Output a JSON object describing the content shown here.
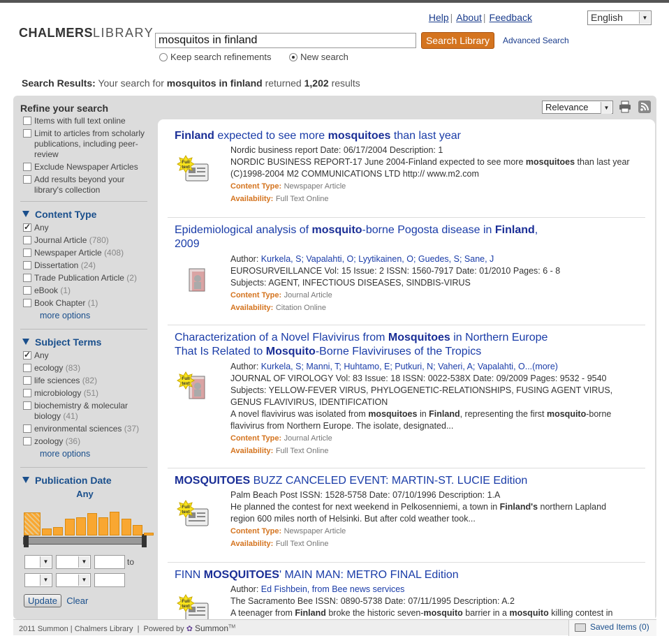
{
  "header": {
    "logo_left": "CHALMERS",
    "logo_right": "LIBRARY",
    "links": [
      "Help",
      "About",
      "Feedback"
    ],
    "language": "English"
  },
  "search": {
    "query": "mosquitos in finland",
    "button_label": "Search Library",
    "advanced_label": "Advanced Search",
    "keep_refinements_label": "Keep search refinements",
    "new_search_label": "New search"
  },
  "summary": {
    "prefix": "Search Results:",
    "middle": "Your search for",
    "query": "mosquitos in finland",
    "returned": "returned",
    "count": "1,202",
    "suffix": "results"
  },
  "sort": {
    "selected": "Relevance"
  },
  "sidebar": {
    "refine_title": "Refine your search",
    "refine_options": [
      "Items with full text online",
      "Limit to articles from scholarly publications, including peer-review",
      "Exclude Newspaper Articles",
      "Add results beyond your library's collection"
    ],
    "content_type": {
      "title": "Content Type",
      "any": "Any",
      "items": [
        {
          "label": "Journal Article",
          "count": "(780)"
        },
        {
          "label": "Newspaper Article",
          "count": "(408)"
        },
        {
          "label": "Dissertation",
          "count": "(24)"
        },
        {
          "label": "Trade Publication Article",
          "count": "(2)"
        },
        {
          "label": "eBook",
          "count": "(1)"
        },
        {
          "label": "Book Chapter",
          "count": "(1)"
        }
      ],
      "more": "more options"
    },
    "subject_terms": {
      "title": "Subject Terms",
      "any": "Any",
      "items": [
        {
          "label": "ecology",
          "count": "(83)"
        },
        {
          "label": "life sciences",
          "count": "(82)"
        },
        {
          "label": "microbiology",
          "count": "(51)"
        },
        {
          "label": "biochemistry & molecular biology",
          "count": "(41)"
        },
        {
          "label": "environmental sciences",
          "count": "(37)"
        },
        {
          "label": "zoology",
          "count": "(36)"
        }
      ],
      "more": "more options"
    },
    "publication_date": {
      "title": "Publication Date",
      "range": "Any",
      "histogram": [
        0.75,
        0.22,
        0.28,
        0.55,
        0.58,
        0.72,
        0.58,
        0.78,
        0.55,
        0.35,
        0.1
      ],
      "to_label": "to",
      "update_label": "Update",
      "clear_label": "Clear"
    }
  },
  "results": [
    {
      "title_parts": [
        [
          "b",
          "Finland"
        ],
        [
          "t",
          " expected to see more "
        ],
        [
          "b",
          "mosquitoes"
        ],
        [
          "t",
          " than last year"
        ]
      ],
      "full_text": true,
      "icon": "newspaper-icon",
      "lines": [
        [
          [
            "t",
            "Nordic business report Date: 06/17/2004 Description: 1"
          ]
        ],
        [
          [
            "t",
            "NORDIC BUSINESS REPORT-17 June 2004-Finland expected to see more "
          ],
          [
            "b",
            "mosquitoes"
          ],
          [
            "t",
            " than last year"
          ]
        ],
        [
          [
            "t",
            "(C)1998-2004 M2 COMMUNICATIONS LTD http:// www.m2.com"
          ]
        ]
      ],
      "content_type": "Newspaper Article",
      "availability": "Full Text Online"
    },
    {
      "title_parts": [
        [
          "t",
          "Epidemiological analysis of "
        ],
        [
          "b",
          "mosquito"
        ],
        [
          "t",
          "-borne Pogosta disease in "
        ],
        [
          "b",
          "Finland"
        ],
        [
          "t",
          ","
        ]
      ],
      "title_line2": "2009",
      "full_text": false,
      "icon": "journal-icon",
      "lines": [
        [
          [
            "t",
            "Author: "
          ],
          [
            "l",
            "Kurkela, S; Vapalahti, O; Lyytikainen, O; Guedes, S; Sane, J"
          ]
        ],
        [
          [
            "t",
            "EUROSURVEILLANCE Vol: 15 Issue: 2 ISSN: 1560-7917 Date: 01/2010 Pages: 6 - 8"
          ]
        ],
        [
          [
            "t",
            "Subjects: AGENT, INFECTIOUS DISEASES, SINDBIS-VIRUS"
          ]
        ]
      ],
      "content_type": "Journal Article",
      "availability": "Citation Online"
    },
    {
      "title_parts": [
        [
          "t",
          "Characterization of a Novel Flavivirus from "
        ],
        [
          "b",
          "Mosquitoes"
        ],
        [
          "t",
          " in Northern Europe"
        ]
      ],
      "title_line2_parts": [
        [
          "t",
          "That Is Related to "
        ],
        [
          "b",
          "Mosquito"
        ],
        [
          "t",
          "-Borne Flaviviruses of the Tropics"
        ]
      ],
      "full_text": true,
      "icon": "journal-icon",
      "lines": [
        [
          [
            "t",
            "Author: "
          ],
          [
            "l",
            "Kurkela, S; Manni, T; Huhtamo, E; Putkuri, N; Vaheri, A; Vapalahti, O...(more)"
          ]
        ],
        [
          [
            "t",
            "JOURNAL OF VIROLOGY Vol: 83 Issue: 18 ISSN: 0022-538X Date: 09/2009 Pages: 9532 - 9540"
          ]
        ],
        [
          [
            "t",
            "Subjects: YELLOW-FEVER VIRUS, PHYLOGENETIC-RELATIONSHIPS, FUSING AGENT VIRUS,"
          ]
        ],
        [
          [
            "t",
            "GENUS FLAVIVIRUS, IDENTIFICATION"
          ]
        ],
        [
          [
            "t",
            "A novel flavivirus was isolated from "
          ],
          [
            "b",
            "mosquitoes"
          ],
          [
            "t",
            " in "
          ],
          [
            "b",
            "Finland"
          ],
          [
            "t",
            ", representing the first "
          ],
          [
            "b",
            "mosquito"
          ],
          [
            "t",
            "-borne"
          ]
        ],
        [
          [
            "t",
            "flavivirus from Northern Europe. The isolate, designated..."
          ]
        ]
      ],
      "content_type": "Journal Article",
      "availability": "Full Text Online"
    },
    {
      "title_parts": [
        [
          "b",
          "MOSQUITOES"
        ],
        [
          "t",
          " BUZZ CANCELED EVENT: MARTIN-ST. LUCIE Edition"
        ]
      ],
      "full_text": true,
      "icon": "newspaper-icon",
      "lines": [
        [
          [
            "t",
            "Palm Beach Post ISSN: 1528-5758 Date: 07/10/1996 Description: 1.A"
          ]
        ],
        [
          [
            "t",
            "He planned the contest for next weekend in Pelkosenniemi, a town in "
          ],
          [
            "b",
            "Finland's"
          ],
          [
            "t",
            " northern Lapland"
          ]
        ],
        [
          [
            "t",
            "region 600 miles north of Helsinki. But after cold weather took..."
          ]
        ]
      ],
      "content_type": "Newspaper Article",
      "availability": "Full Text Online"
    },
    {
      "title_parts": [
        [
          "t",
          "FINN "
        ],
        [
          "b",
          "MOSQUITOES"
        ],
        [
          "t",
          "' MAIN MAN: METRO FINAL Edition"
        ]
      ],
      "full_text": true,
      "icon": "newspaper-icon",
      "lines": [
        [
          [
            "t",
            "Author: "
          ],
          [
            "l",
            "Ed Fishbein, from Bee news services"
          ]
        ],
        [
          [
            "t",
            "The Sacramento Bee ISSN: 0890-5738 Date: 07/11/1995 Description: A.2"
          ]
        ],
        [
          [
            "t",
            "A teenager from "
          ],
          [
            "b",
            "Finland"
          ],
          [
            "t",
            " broke the historic seven-"
          ],
          [
            "b",
            "mosquito"
          ],
          [
            "t",
            " barrier in a "
          ],
          [
            "b",
            "mosquito"
          ],
          [
            "t",
            " killing contest in"
          ]
        ]
      ],
      "content_type": "",
      "availability": ""
    }
  ],
  "labels": {
    "full_text_badge": "Full text",
    "content_type": "Content Type:",
    "availability": "Availability:"
  },
  "footer": {
    "copyright": "2011 Summon | Chalmers Library",
    "powered_by": "Powered by",
    "summon": "Summon",
    "tm": "TM",
    "saved_items": "Saved Items (0)"
  }
}
